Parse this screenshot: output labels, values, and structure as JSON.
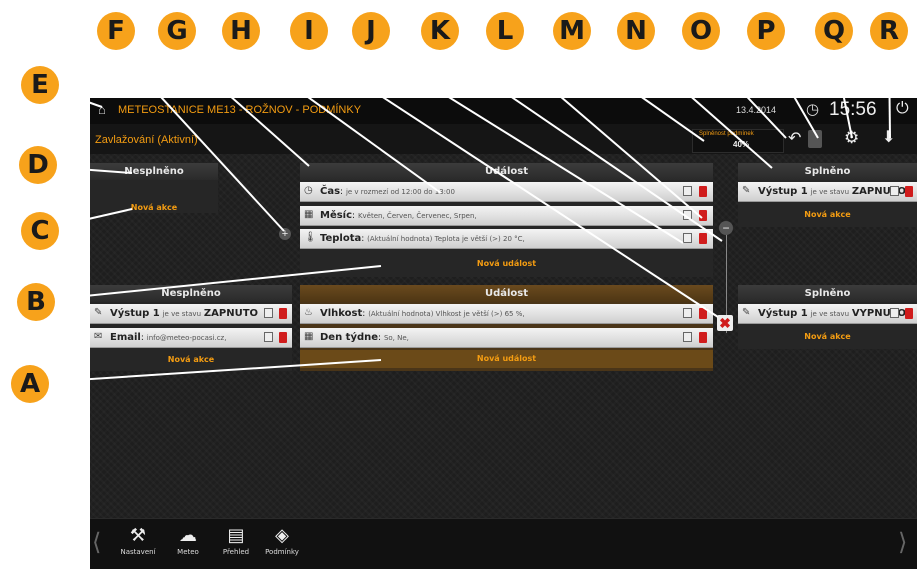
{
  "callouts": [
    "A",
    "B",
    "C",
    "D",
    "E",
    "F",
    "G",
    "H",
    "I",
    "J",
    "K",
    "L",
    "M",
    "N",
    "O",
    "P",
    "Q",
    "R"
  ],
  "topbar": {
    "title": "METEOSTANICE ME13 - ROŽNOV - PODMÍNKY",
    "date": "13.4.2014",
    "time": "15:56"
  },
  "subbar": {
    "heading": "Zavlažování (Aktivní)",
    "progress_label": "Splněnost podmínek",
    "progress_value": "40%",
    "progress_fraction": 0.4
  },
  "group1": {
    "left_header": "Nesplněno",
    "left_new_action": "Nová akce",
    "event_header": "Událost",
    "events": [
      {
        "icon": "clock-icon",
        "name": "Čas",
        "detail": "je v rozmezí od 12:00 do 13:00"
      },
      {
        "icon": "calendar-icon",
        "name": "Měsíc",
        "detail": "Květen, Červen, Červenec, Srpen,"
      },
      {
        "icon": "thermometer-icon",
        "name": "Teplota",
        "detail": "(Aktuální hodnota) Teplota je větší (>) 20 °C,"
      }
    ],
    "new_event": "Nová událost",
    "right_header": "Splněno",
    "right_row": {
      "name": "Výstup 1",
      "mid": "je ve stavu",
      "state": "ZAPNUTO"
    },
    "right_new_action": "Nová akce"
  },
  "group2": {
    "left_header": "Nesplněno",
    "left_rows": [
      {
        "icon": "plug-icon",
        "name": "Výstup 1",
        "mid": "je ve stavu",
        "state": "ZAPNUTO"
      },
      {
        "icon": "envelope-icon",
        "name": "Email",
        "mid": "info@meteo-pocasi.cz,",
        "state": ""
      }
    ],
    "left_new_action": "Nová akce",
    "event_header": "Událost",
    "events": [
      {
        "icon": "humidity-icon",
        "name": "Vlhkost",
        "detail": "(Aktuální hodnota) Vlhkost je větší (>) 65 %,"
      },
      {
        "icon": "calendar-icon",
        "name": "Den týdne",
        "detail": "So, Ne,"
      }
    ],
    "new_event": "Nová událost",
    "right_header": "Splněno",
    "right_row": {
      "name": "Výstup 1",
      "mid": "je ve stavu",
      "state": "VYPNUTO"
    },
    "right_new_action": "Nová akce"
  },
  "dock": [
    {
      "icon": "tools-icon",
      "label": "Nastavení"
    },
    {
      "icon": "weather-icon",
      "label": "Meteo"
    },
    {
      "icon": "chart-icon",
      "label": "Přehled"
    },
    {
      "icon": "conditions-icon",
      "label": "Podmínky"
    }
  ],
  "colors": {
    "accent": "#f39c12",
    "callout": "#f7a21b",
    "delete": "#d01c1c"
  }
}
